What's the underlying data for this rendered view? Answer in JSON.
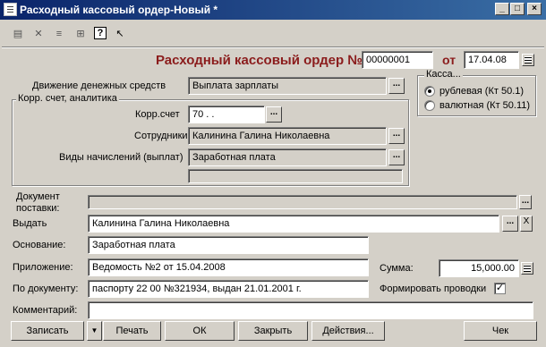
{
  "window": {
    "title": "Расходный кассовый ордер-Новый *",
    "controls": [
      "_",
      "□",
      "×"
    ]
  },
  "toolbar": {
    "icons": [
      "doc-new-icon",
      "doc-delete-icon",
      "doc-list-icon",
      "doc-structure-icon",
      "help-icon",
      "pointer-help-icon"
    ]
  },
  "header": {
    "title": "Расходный кассовый ордер №",
    "number": "00000001",
    "date_label": "от",
    "date": "17.04.08"
  },
  "movement": {
    "label": "Движение денежных средств",
    "value": "Выплата зарплаты"
  },
  "cash": {
    "title": "Касса...",
    "option1": "рублевая (Кт 50.1)",
    "option2": "валютная (Кт 50.11)",
    "selected": "option1"
  },
  "account_group": {
    "title": "Корр. счет, аналитика",
    "account_label": "Корр.счет",
    "account_value": "70 . .",
    "employees_label": "Сотрудники",
    "employees_value": "Калинина Галина Николаевна",
    "accruals_label": "Виды начислений (выплат)",
    "accruals_value": "Заработная плата",
    "extra_value": ""
  },
  "form": {
    "supply_doc_label_1": "Документ",
    "supply_doc_label_2": "поставки:",
    "supply_doc_value": "",
    "issue_label": "Выдать",
    "issue_value": "Калинина Галина Николаевна",
    "basis_label": "Основание:",
    "basis_value": "Заработная плата",
    "attachment_label": "Приложение:",
    "attachment_value": "Ведомость №2 от 15.04.2008",
    "amount_label": "Сумма:",
    "amount_value": "15,000.00",
    "by_doc_label": "По документу:",
    "by_doc_value": "паспорту  22 00 №321934, выдан 21.01.2001 г.",
    "postings_label": "Формировать проводки",
    "postings_checked": "✓",
    "comment_label": "Комментарий:",
    "comment_value": ""
  },
  "buttons": {
    "save": "Записать",
    "dropdown": "▼",
    "print": "Печать",
    "ok": "ОК",
    "close": "Закрыть",
    "actions": "Действия...",
    "receipt": "Чек"
  },
  "colors": {
    "titlebar": "#0a246a",
    "headline": "#8b1c1c",
    "window_bg": "#d4d0c8"
  }
}
